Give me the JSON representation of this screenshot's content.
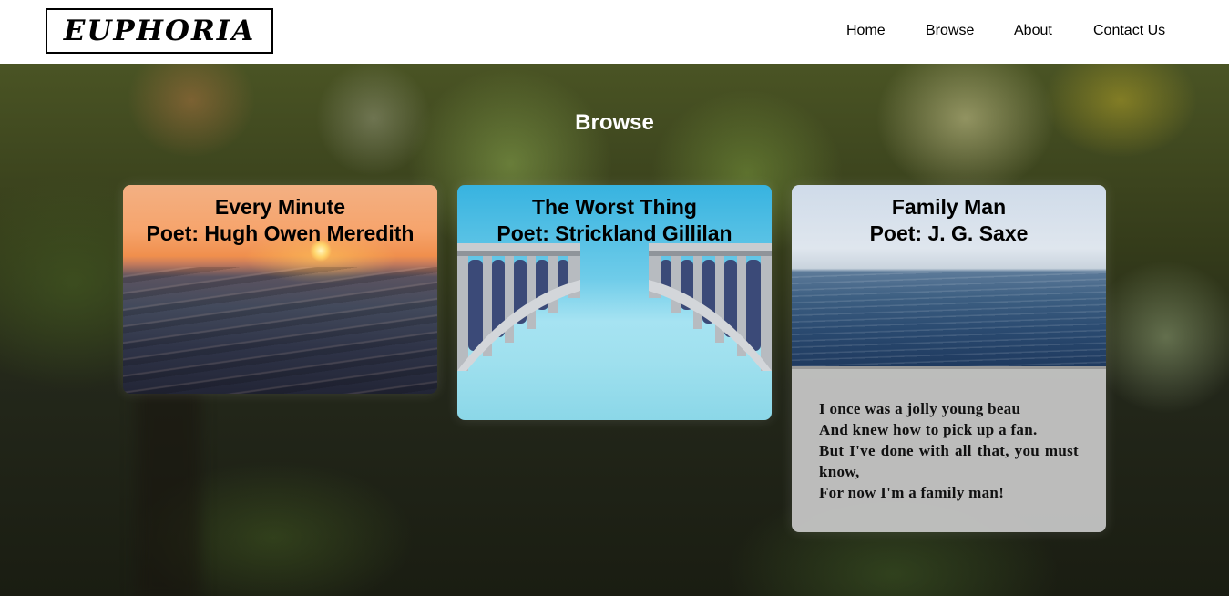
{
  "header": {
    "logo": "EUPHORIA",
    "nav": [
      {
        "label": "Home"
      },
      {
        "label": "Browse"
      },
      {
        "label": "About"
      },
      {
        "label": "Contact Us"
      }
    ]
  },
  "main": {
    "title": "Browse",
    "cards": [
      {
        "title": "Every Minute",
        "poet": "Poet: Hugh Owen Meredith",
        "image": "sunset-ocean-waves"
      },
      {
        "title": "The Worst Thing",
        "poet": "Poet: Strickland Gillilan",
        "image": "broken-bridge"
      },
      {
        "title": "Family Man",
        "poet": "Poet: J. G. Saxe",
        "image": "calm-sea",
        "poem_lines": [
          "I once was a jolly young beau",
          "And knew how to pick up a fan.",
          "But I've done with all that, you must know,",
          "For now I'm a family man!"
        ]
      }
    ]
  }
}
